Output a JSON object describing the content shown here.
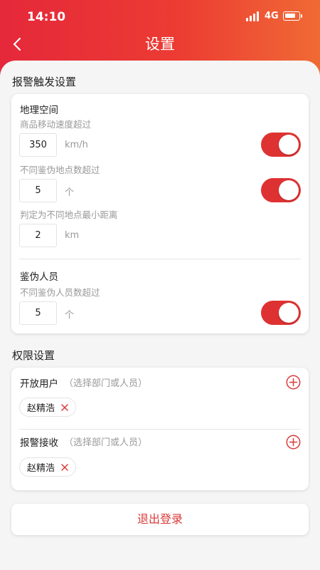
{
  "status_bar": {
    "time": "14:10",
    "network": "4G"
  },
  "header": {
    "title": "设置"
  },
  "alarm_section": {
    "label": "报警触发设置",
    "geo": {
      "title": "地理空间",
      "speed": {
        "hint": "商品移动速度超过",
        "value": "350",
        "unit": "km/h",
        "enabled": true
      },
      "locations": {
        "hint": "不同鉴伪地点数超过",
        "value": "5",
        "unit": "个",
        "enabled": true
      },
      "distance": {
        "hint": "判定为不同地点最小距离",
        "value": "2",
        "unit": "km"
      }
    },
    "staff": {
      "title": "鉴伪人员",
      "count": {
        "hint": "不同鉴伪人员数超过",
        "value": "5",
        "unit": "个",
        "enabled": true
      }
    }
  },
  "permission_section": {
    "label": "权限设置",
    "open_users": {
      "title": "开放用户",
      "sub": "（选择部门或人员）",
      "chips": [
        "赵精浩"
      ]
    },
    "alarm_receivers": {
      "title": "报警接收",
      "sub": "（选择部门或人员）",
      "chips": [
        "赵精浩"
      ]
    }
  },
  "logout_label": "退出登录",
  "colors": {
    "accent": "#de3232",
    "header_start": "#e5283a",
    "header_end": "#f06a34"
  }
}
